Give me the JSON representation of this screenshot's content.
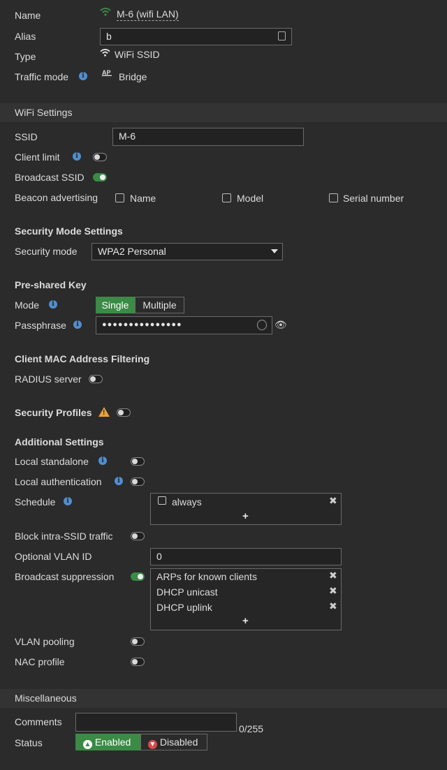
{
  "interface": {
    "name_label": "Name",
    "name_value": "M-6 (wifi LAN)",
    "alias_label": "Alias",
    "alias_value": "b",
    "type_label": "Type",
    "type_value": "WiFi SSID",
    "traffic_mode_label": "Traffic mode",
    "traffic_mode_value": "Bridge",
    "traffic_mode_icon": "AP"
  },
  "wifi_settings": {
    "header": "WiFi Settings",
    "ssid_label": "SSID",
    "ssid_value": "M-6",
    "client_limit_label": "Client limit",
    "broadcast_ssid_label": "Broadcast SSID",
    "beacon_label": "Beacon advertising",
    "beacon_options": [
      "Name",
      "Model",
      "Serial number"
    ]
  },
  "security_mode": {
    "header": "Security Mode Settings",
    "mode_label": "Security mode",
    "mode_value": "WPA2 Personal"
  },
  "psk": {
    "header": "Pre-shared Key",
    "mode_label": "Mode",
    "mode_single": "Single",
    "mode_multiple": "Multiple",
    "passphrase_label": "Passphrase",
    "passphrase_value": "●●●●●●●●●●●●●●●"
  },
  "mac_filter": {
    "header": "Client MAC Address Filtering",
    "radius_label": "RADIUS server"
  },
  "security_profiles": {
    "label": "Security Profiles"
  },
  "additional": {
    "header": "Additional Settings",
    "local_standalone": "Local standalone",
    "local_auth": "Local authentication",
    "schedule_label": "Schedule",
    "schedule_items": [
      "always"
    ],
    "block_intra": "Block intra-SSID traffic",
    "vlan_id_label": "Optional VLAN ID",
    "vlan_id_value": "0",
    "broadcast_suppression": "Broadcast suppression",
    "suppression_items": [
      "ARPs for known clients",
      "DHCP unicast",
      "DHCP uplink"
    ],
    "vlan_pooling": "VLAN pooling",
    "nac_profile": "NAC profile",
    "plus": "+"
  },
  "misc": {
    "header": "Miscellaneous",
    "comments_label": "Comments",
    "comments_count": "0/255",
    "status_label": "Status",
    "enabled": "Enabled",
    "disabled": "Disabled"
  },
  "colors": {
    "accent_green": "#3b8a45",
    "info_blue": "#4f8fd1",
    "warning": "#e8a33a",
    "disabled_red": "#d94a4a"
  }
}
